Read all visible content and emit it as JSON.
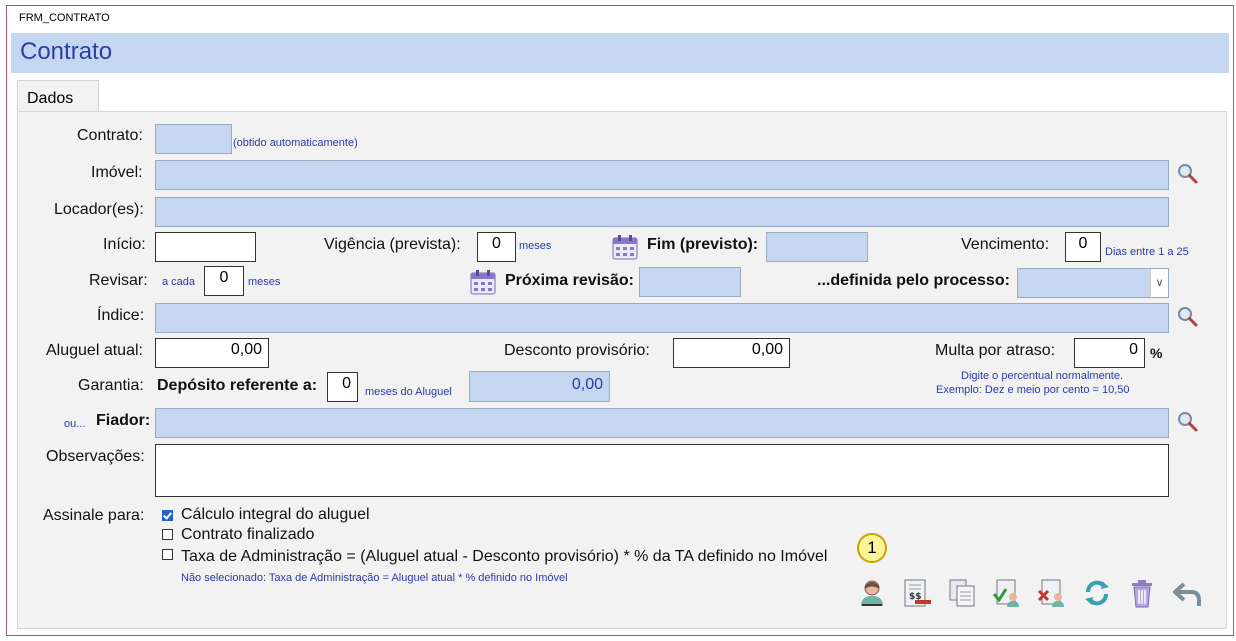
{
  "window": {
    "title": "FRM_CONTRATO"
  },
  "header": {
    "title": "Contrato"
  },
  "tabs": [
    {
      "label": "Dados"
    }
  ],
  "form": {
    "contrato": {
      "label": "Contrato:",
      "value": "",
      "hint": "(obtido automaticamente)"
    },
    "imovel": {
      "label": "Imóvel:",
      "value": ""
    },
    "locador": {
      "label": "Locador(es):",
      "value": ""
    },
    "inicio": {
      "label": "Início:",
      "value": ""
    },
    "vigencia": {
      "label": "Vigência (prevista):",
      "value": "0",
      "unit": "meses"
    },
    "fim": {
      "label": "Fim (previsto):",
      "value": ""
    },
    "vencimento": {
      "label": "Vencimento:",
      "value": "0",
      "hint": "Dias entre 1 a 25"
    },
    "revisar": {
      "label": "Revisar:",
      "prefix": "a cada",
      "value": "0",
      "unit": "meses"
    },
    "proxima_revisao": {
      "label": "Próxima revisão:",
      "value": ""
    },
    "processo": {
      "label": "...definida pelo processo:",
      "value": ""
    },
    "indice": {
      "label": "Índice:",
      "value": ""
    },
    "aluguel_atual": {
      "label": "Aluguel atual:",
      "value": "0,00"
    },
    "desconto": {
      "label": "Desconto provisório:",
      "value": "0,00"
    },
    "multa": {
      "label": "Multa por atraso:",
      "value": "0",
      "unit": "%",
      "hint1": "Digite o percentual normalmente.",
      "hint2": "Exemplo: Dez e meio por cento = 10,50"
    },
    "garantia": {
      "label": "Garantia:",
      "sublabel": "Depósito referente a:",
      "value": "0",
      "unit": "meses do Aluguel",
      "amount": "0,00"
    },
    "fiador": {
      "prefix": "ou...",
      "label": "Fiador:",
      "value": ""
    },
    "observacoes": {
      "label": "Observações:",
      "value": ""
    },
    "assinale": {
      "label": "Assinale para:",
      "options": [
        {
          "label": "Cálculo integral do aluguel",
          "checked": true
        },
        {
          "label": "Contrato finalizado",
          "checked": false
        },
        {
          "label": "Taxa de Administração = (Aluguel atual -  Desconto provisório) * % da TA definido no Imóvel",
          "checked": false
        }
      ],
      "note": "Não selecionado: Taxa de Administração = Aluguel atual * % definido no Imóvel"
    }
  },
  "badge": {
    "number": "1"
  },
  "colors": {
    "field_blue": "#c5d7f0",
    "header_blue": "#c5d7f0",
    "title_blue": "#2b3fa0",
    "hint_blue": "#2a3aa8"
  },
  "toolbar_icons": [
    "person-icon",
    "money-document-icon",
    "copy-document-icon",
    "approve-person-icon",
    "reject-person-icon",
    "refresh-icon",
    "trash-icon",
    "back-arrow-icon"
  ]
}
